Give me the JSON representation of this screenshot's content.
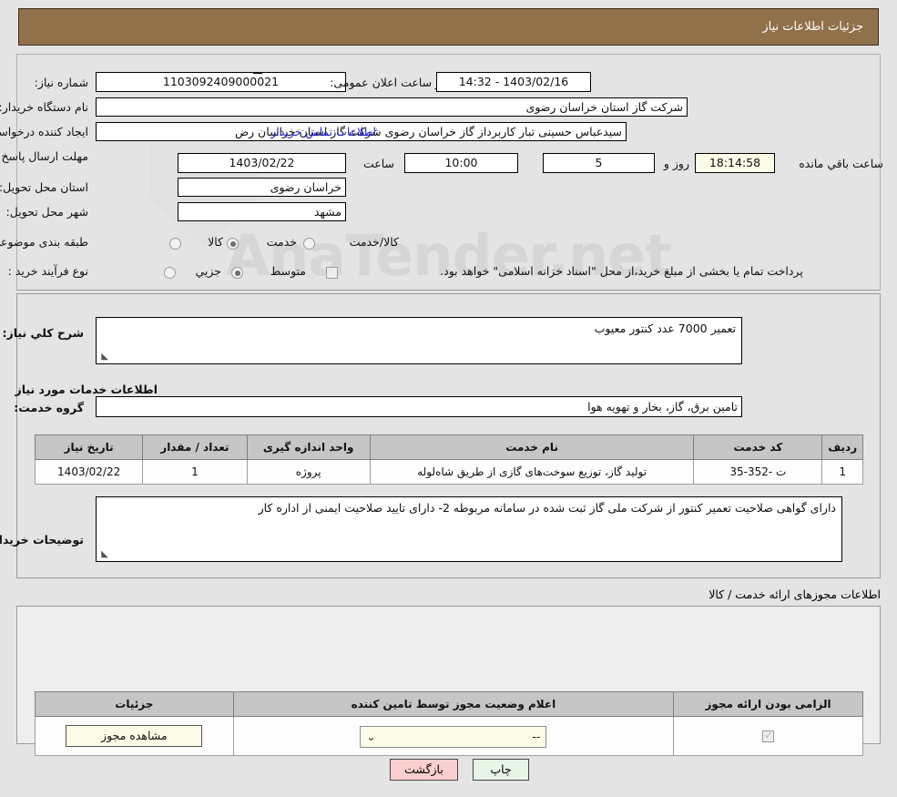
{
  "window": {
    "title": "جزئیات اطلاعات نیاز"
  },
  "watermark": {
    "text": "AnaTender.net"
  },
  "top_form": {
    "need_number": {
      "label": "شماره نیاز:",
      "value": "1103092409000021"
    },
    "announce_datetime": {
      "label": "تاریخ و ساعت اعلان عمومی:",
      "value": "1403/02/16 - 14:32"
    },
    "buyer_org": {
      "label": "نام دستگاه خریدار:",
      "value": "شرکت گاز استان خراسان رضوی"
    },
    "request_creator": {
      "label": "ایجاد کننده درخواست:",
      "value": "سیدعباس حسینی تبار کاربرداز گاز خراسان رضوی شرکت گاز استان خراسان رض"
    },
    "buyer_contact_link": "اطلاعات تماس خریدار",
    "deadline": {
      "label": "مهلت ارسال پاسخ: تا تاریخ:",
      "date": "1403/02/22",
      "time_label": "ساعت",
      "time": "10:00",
      "days": "5",
      "days_label": "روز و",
      "countdown": "18:14:58",
      "remaining_label": "ساعت باقي مانده"
    },
    "delivery_province": {
      "label": "استان محل تحویل:",
      "value": "خراسان رضوی"
    },
    "delivery_city": {
      "label": "شهر محل تحویل:",
      "value": "مشهد"
    },
    "category": {
      "label": "طبقه بندی موضوعی:",
      "options": [
        "کالا",
        "خدمت",
        "کالا/خدمت"
      ],
      "selected": "خدمت"
    },
    "purchase_type": {
      "label": "نوع فرآیند خرید :",
      "options": [
        "جزيي",
        "متوسط"
      ],
      "selected": "متوسط"
    },
    "treasury_checkbox": {
      "checked": false,
      "text": "پرداخت تمام یا بخشی از مبلغ خرید،از محل \"اسناد خزانه اسلامی\" خواهد بود."
    }
  },
  "description": {
    "general_need": {
      "label": "شرح کلي نیاز:",
      "value": "تعمیر 7000 عدد  کنتور معیوب"
    },
    "section_title": "اطلاعات خدمات مورد نیاز",
    "service_group": {
      "label": "گروه خدمت:",
      "value": "تامین برق، گاز، بخار و تهویه هوا"
    },
    "services_table": {
      "headers": [
        "ردیف",
        "کد خدمت",
        "نام خدمت",
        "واحد اندازه گیری",
        "تعداد / مقدار",
        "تاریخ نیاز"
      ],
      "rows": [
        [
          "1",
          "ت -352-35",
          "تولید گاز، توزیع سوخت‌های گازی از طریق شاه‌لوله",
          "پروژه",
          "1",
          "1403/02/22"
        ]
      ]
    },
    "buyer_notes": {
      "label": "توضیحات خریدار:",
      "value": "دارای گواهی صلاحیت  تعمیر کنتور از شرکت ملی گاز ثبت شده در سامانه مربوطه 2- دارای تایید صلاحیت ایمنی از اداره کار"
    }
  },
  "permits": {
    "section_label": "اطلاعات مجوزهای ارائه خدمت / کالا",
    "table": {
      "headers": [
        "الزامی بودن ارائه مجوز",
        "اعلام وضعیت مجوز توسط تامین کننده",
        "جزئیات"
      ],
      "rows": [
        {
          "required": true,
          "status": "--",
          "details_button": "مشاهده مجوز"
        }
      ]
    }
  },
  "footer": {
    "print_button": "چاپ",
    "back_button": "بازگشت"
  },
  "colors": {
    "header_bg": "#90714a",
    "link": "#2222dd",
    "print_btn": "#e6f5e6",
    "back_btn": "#fbcfcf",
    "field_yellow": "#fbfbe8"
  }
}
